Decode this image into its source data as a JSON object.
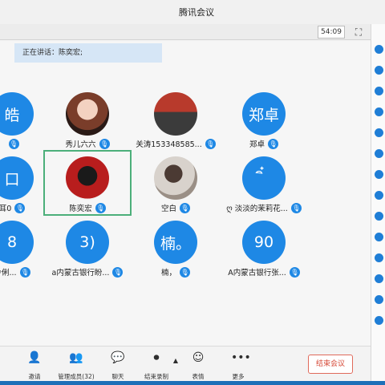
{
  "window": {
    "title": "腾讯会议"
  },
  "toolbar": {
    "timer": "54:09",
    "fullscreen_icon": "fullscreen-icon"
  },
  "speaking": {
    "text": "正在讲话：陈奕宏;"
  },
  "participants": [
    {
      "name": "",
      "avatar_text": "皓",
      "avatar_type": "text"
    },
    {
      "name": "秀儿六六",
      "avatar_text": "",
      "avatar_type": "photo1"
    },
    {
      "name": "关涛153348585...",
      "avatar_text": "",
      "avatar_type": "photo2"
    },
    {
      "name": "郑卓",
      "avatar_text": "郑卓",
      "avatar_type": "text"
    },
    {
      "name": "耳0",
      "avatar_text": "口",
      "avatar_type": "text"
    },
    {
      "name": "陈奕宏",
      "avatar_text": "",
      "avatar_type": "photo3"
    },
    {
      "name": "空白",
      "avatar_text": "",
      "avatar_type": "photo4"
    },
    {
      "name": "ღ 淡淡的茉莉花...",
      "avatar_text": "ิ๋",
      "avatar_type": "text"
    },
    {
      "name": "怜俐...",
      "avatar_text": "8",
      "avatar_type": "text"
    },
    {
      "name": "a内蒙古银行盼...",
      "avatar_text": "3)",
      "avatar_type": "text"
    },
    {
      "name": "楠，",
      "avatar_text": "楠。",
      "avatar_type": "text"
    },
    {
      "name": "A内蒙古银行张...",
      "avatar_text": "90",
      "avatar_type": "text"
    }
  ],
  "bottom_toolbar": {
    "items": [
      {
        "label": "邀请",
        "icon": "invite-icon"
      },
      {
        "label": "管理成员(32)",
        "icon": "members-icon"
      },
      {
        "label": "聊天",
        "icon": "chat-icon"
      },
      {
        "label": "结束录制",
        "icon": "record-icon"
      },
      {
        "label": "表情",
        "icon": "emoji-icon"
      },
      {
        "label": "更多",
        "icon": "more-icon"
      }
    ],
    "end_button": "结束会议"
  },
  "colors": {
    "accent": "#1e88e5",
    "active_border": "#4caf7a",
    "end_red": "#d64a38"
  }
}
